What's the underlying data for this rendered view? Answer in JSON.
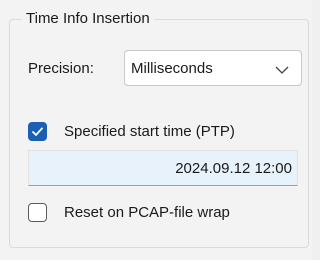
{
  "group": {
    "title": "Time Info Insertion"
  },
  "precision": {
    "label": "Precision:",
    "selected": "Milliseconds"
  },
  "start_time": {
    "label": "Specified start time (PTP)",
    "checked": true,
    "value": "2024.09.12 12:00"
  },
  "reset": {
    "label": "Reset on PCAP-file wrap",
    "checked": false
  },
  "colors": {
    "accent": "#1a5fb4",
    "field_bg": "#e8f2fb",
    "panel_bg": "#f3f3f3"
  },
  "icons": {
    "dropdown": "chevron-down-icon",
    "check": "checkmark-icon"
  }
}
